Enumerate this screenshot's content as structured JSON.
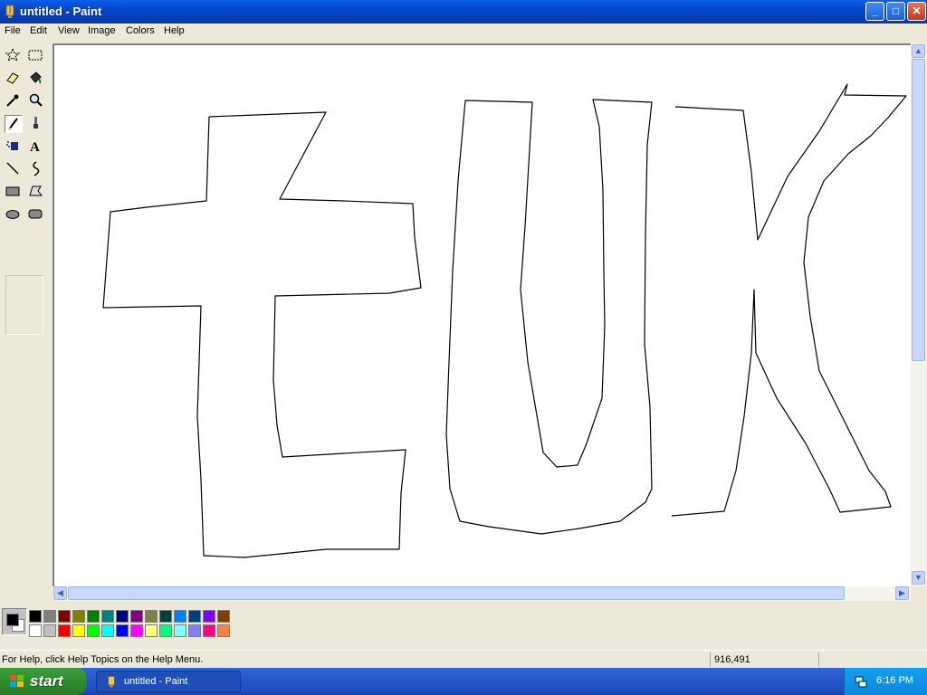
{
  "window": {
    "title": "untitled - Paint",
    "buttons": {
      "minimize": "_",
      "maximize": "□",
      "close": "✕"
    }
  },
  "menu": [
    "File",
    "Edit",
    "View",
    "Image",
    "Colors",
    "Help"
  ],
  "tools": [
    {
      "name": "free-form-select-tool",
      "icon": "dashed-star-icon"
    },
    {
      "name": "select-tool",
      "icon": "dashed-rectangle-icon"
    },
    {
      "name": "eraser-tool",
      "icon": "eraser-icon"
    },
    {
      "name": "fill-tool",
      "icon": "paint-bucket-icon"
    },
    {
      "name": "pick-color-tool",
      "icon": "eyedropper-icon"
    },
    {
      "name": "magnifier-tool",
      "icon": "magnifier-icon"
    },
    {
      "name": "pencil-tool",
      "icon": "pencil-icon",
      "selected": true
    },
    {
      "name": "brush-tool",
      "icon": "brush-icon"
    },
    {
      "name": "airbrush-tool",
      "icon": "airbrush-icon"
    },
    {
      "name": "text-tool",
      "icon": "text-a-icon"
    },
    {
      "name": "line-tool",
      "icon": "line-icon"
    },
    {
      "name": "curve-tool",
      "icon": "curve-icon"
    },
    {
      "name": "rectangle-tool",
      "icon": "rectangle-icon"
    },
    {
      "name": "polygon-tool",
      "icon": "polygon-icon"
    },
    {
      "name": "ellipse-tool",
      "icon": "ellipse-icon"
    },
    {
      "name": "rounded-rectangle-tool",
      "icon": "rounded-rectangle-icon"
    }
  ],
  "colors": {
    "foreground": "#000000",
    "background": "#ffffff",
    "palette_top": [
      "#000000",
      "#808080",
      "#800000",
      "#808000",
      "#008000",
      "#008080",
      "#000080",
      "#800080",
      "#808040",
      "#004040",
      "#0080ff",
      "#004080",
      "#8000ff",
      "#804000"
    ],
    "palette_bottom": [
      "#ffffff",
      "#c0c0c0",
      "#ff0000",
      "#ffff00",
      "#00ff00",
      "#00ffff",
      "#0000ff",
      "#ff00ff",
      "#ffff80",
      "#00ff80",
      "#80ffff",
      "#8080ff",
      "#ff0080",
      "#ff8040"
    ]
  },
  "status": {
    "help_text": "For Help, click Help Topics on the Help Menu.",
    "coordinates": "916,491"
  },
  "taskbar": {
    "start_label": "start",
    "task_button": "untitled - Paint",
    "clock": "6:16 PM"
  }
}
